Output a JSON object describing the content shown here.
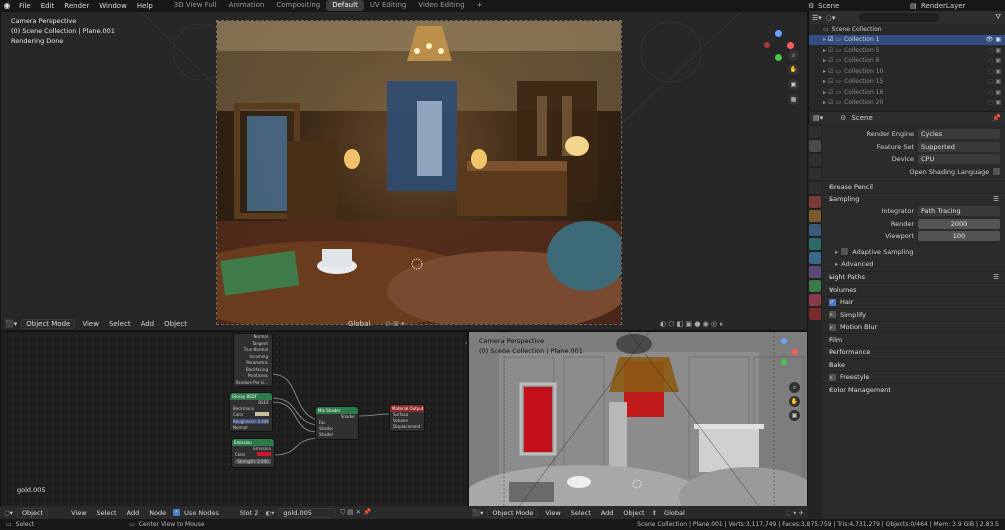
{
  "topbar": {
    "menus": [
      "File",
      "Edit",
      "Render",
      "Window",
      "Help"
    ],
    "workspaces": [
      "3D View Full",
      "Animation",
      "Compositing",
      "Default",
      "UV Editing",
      "Video Editing"
    ],
    "active_workspace": "Default",
    "scene": "Scene",
    "view_layer": "RenderLayer"
  },
  "viewport": {
    "line1": "Camera Perspective",
    "line2": "(0) Scene Collection | Plane.001",
    "line3": "Rendering Done",
    "header": {
      "mode": "Object Mode",
      "view": "View",
      "select": "Select",
      "add": "Add",
      "object": "Object",
      "transform": "Global"
    }
  },
  "outliner": {
    "title": "Scene Collection",
    "items": [
      "Collection 1",
      "Collection 5",
      "Collection 6",
      "Collection 10",
      "Collection 15",
      "Collection 16",
      "Collection 20"
    ]
  },
  "properties": {
    "scene_name": "Scene",
    "render_engine_label": "Render Engine",
    "render_engine": "Cycles",
    "feature_set_label": "Feature Set",
    "feature_set": "Supported",
    "device_label": "Device",
    "device": "CPU",
    "osl_label": "Open Shading Language",
    "grease_pencil": "Grease Pencil",
    "sampling": "Sampling",
    "integrator_label": "Integrator",
    "integrator": "Path Tracing",
    "render_label": "Render",
    "render_samples": "2000",
    "viewport_label": "Viewport",
    "viewport_samples": "100",
    "adaptive_sampling": "Adaptive Sampling",
    "advanced": "Advanced",
    "light_paths": "Light Paths",
    "volumes": "Volumes",
    "hair": "Hair",
    "simplify": "Simplify",
    "motion_blur": "Motion Blur",
    "film": "Film",
    "performance": "Performance",
    "bake": "Bake",
    "freestyle": "Freestyle",
    "color_management": "Color Management"
  },
  "node_editor": {
    "material_label": "gold.005",
    "header": {
      "object": "Object",
      "view": "View",
      "select": "Select",
      "add": "Add",
      "node": "Node",
      "use_nodes": "Use Nodes",
      "slot": "Slot 2",
      "material": "gold.005"
    },
    "nodes": {
      "geometry_outputs": [
        "Normal",
        "Tangent",
        "True Normal",
        "Incoming",
        "Parametric",
        "Backfacing",
        "Pointiness",
        "Random Per Is..."
      ],
      "glossy": {
        "title": "Glossy BSDF",
        "out": "BSDF",
        "dist": "Beckmann",
        "color": "Color",
        "roughness": "Roughness: 0.446",
        "normal": "Normal"
      },
      "emission": {
        "title": "Emission",
        "out": "Emission",
        "color": "Color",
        "strength": "Strength: 2.000"
      },
      "mix": {
        "title": "Mix Shader",
        "out": "Shader",
        "fac": "Fac",
        "s1": "Shader",
        "s2": "Shader"
      },
      "output": {
        "title": "Material Output",
        "surface": "Surface",
        "volume": "Volume",
        "displacement": "Displacement"
      }
    }
  },
  "viewport2": {
    "line1": "Camera Perspective",
    "line2": "(0) Scene Collection | Plane.001",
    "header": {
      "mode": "Object Mode",
      "view": "View",
      "select": "Select",
      "add": "Add",
      "object": "Object",
      "transform": "Global"
    }
  },
  "status": {
    "select": "Select",
    "center": "Center View to Mouse",
    "stats": "Scene Collection | Plane.001 | Verts:3,117,749 | Faces:3,875,759 | Tris:4,731,279 | Objects:0/464 | Mem: 3.9 GiB | 2.83.5"
  }
}
